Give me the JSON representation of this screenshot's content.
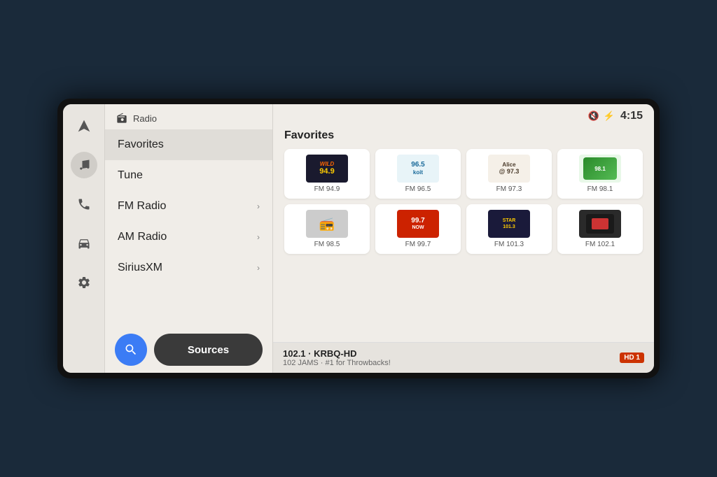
{
  "screen": {
    "title": "Radio"
  },
  "nav": {
    "icons": [
      {
        "name": "navigation",
        "symbol": "◂",
        "active": false
      },
      {
        "name": "music",
        "symbol": "♪",
        "active": true
      },
      {
        "name": "phone",
        "symbol": "✆",
        "active": false
      },
      {
        "name": "car",
        "symbol": "🚗",
        "active": false
      },
      {
        "name": "settings",
        "symbol": "⚙",
        "active": false
      }
    ]
  },
  "sidebar": {
    "header_icon": "radio",
    "header_label": "Radio",
    "items": [
      {
        "label": "Favorites",
        "active": true,
        "has_arrow": false
      },
      {
        "label": "Tune",
        "active": false,
        "has_arrow": false
      },
      {
        "label": "FM Radio",
        "active": false,
        "has_arrow": true
      },
      {
        "label": "AM Radio",
        "active": false,
        "has_arrow": true
      },
      {
        "label": "SiriusXM",
        "active": false,
        "has_arrow": true
      }
    ],
    "search_label": "Search",
    "sources_label": "Sources"
  },
  "topbar": {
    "time": "4:15",
    "icons": [
      "signal-off",
      "bluetooth"
    ]
  },
  "main": {
    "section_title": "Favorites",
    "stations": [
      {
        "id": "wild",
        "logo_text": "WILD 94.9",
        "freq": "FM 94.9",
        "style": "wild"
      },
      {
        "id": "koit",
        "logo_text": "96.5 koit",
        "freq": "FM 96.5",
        "style": "koit"
      },
      {
        "id": "alice",
        "logo_text": "Alice @ 97.3",
        "freq": "FM 97.3",
        "style": "alice"
      },
      {
        "id": "fm981",
        "logo_text": "Green",
        "freq": "FM 98.1",
        "style": "98"
      },
      {
        "id": "fm985",
        "logo_text": "📻",
        "freq": "FM 98.5",
        "style": "radio-icon"
      },
      {
        "id": "now997",
        "logo_text": "99.7 NOW",
        "freq": "FM 99.7",
        "style": "now"
      },
      {
        "id": "star1013",
        "logo_text": "STAR101.3",
        "freq": "FM 101.3",
        "style": "star"
      },
      {
        "id": "fm1021",
        "logo_text": "■",
        "freq": "FM 102.1",
        "style": "dark"
      }
    ],
    "now_playing": {
      "station": "102.1 · KRBQ-HD",
      "description": "102 JAMS · #1 for Throwbacks!",
      "badge": "HD 1"
    }
  }
}
